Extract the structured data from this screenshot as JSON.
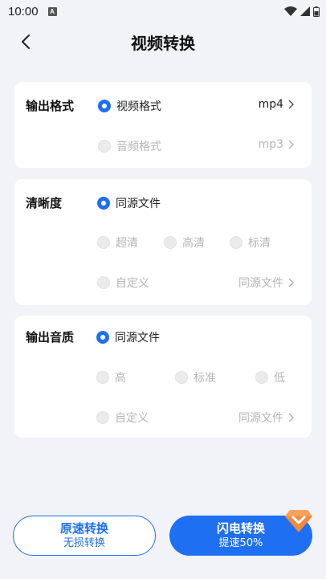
{
  "status_bar": {
    "time": "10:00",
    "notification_letter": "A"
  },
  "header": {
    "title": "视频转换"
  },
  "output_format": {
    "label": "输出格式",
    "options": [
      {
        "label": "视频格式",
        "value": "mp4",
        "selected": true,
        "enabled": true
      },
      {
        "label": "音频格式",
        "value": "mp3",
        "selected": false,
        "enabled": false
      }
    ]
  },
  "clarity": {
    "label": "清晰度",
    "selected_option": "同源文件",
    "options": [
      "超清",
      "高清",
      "标清"
    ],
    "custom_label": "自定义",
    "custom_value": "同源文件"
  },
  "audio_quality": {
    "label": "输出音质",
    "selected_option": "同源文件",
    "options": [
      "高",
      "标准",
      "低"
    ],
    "custom_label": "自定义",
    "custom_value": "同源文件"
  },
  "buttons": {
    "normal": {
      "title": "原速转换",
      "subtitle": "无损转换"
    },
    "flash": {
      "title": "闪电转换",
      "subtitle": "提速50%"
    }
  },
  "colors": {
    "accent": "#1f6ff2",
    "background": "#f2f3f8",
    "vip": "#f08a3c"
  }
}
